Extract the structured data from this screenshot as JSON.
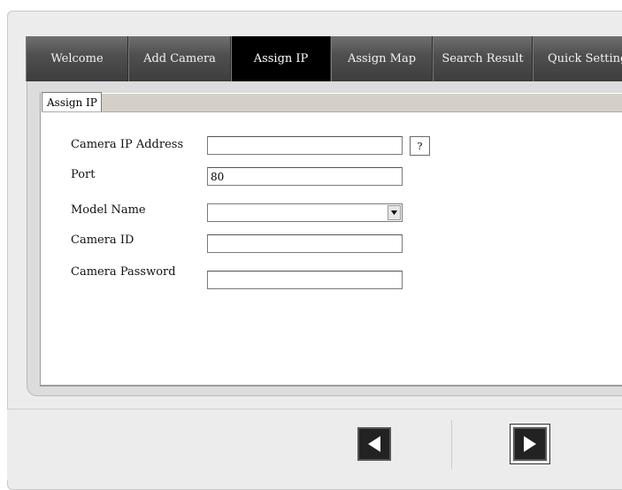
{
  "tabs": [
    {
      "label": "Welcome",
      "active": false
    },
    {
      "label": "Add Camera",
      "active": false
    },
    {
      "label": "Assign IP",
      "active": true
    },
    {
      "label": "Assign Map",
      "active": false
    },
    {
      "label": "Search Result",
      "active": false
    },
    {
      "label": "Quick Settings",
      "active": false
    }
  ],
  "panel": {
    "subtab_label": "Assign IP"
  },
  "form": {
    "camera_ip": {
      "label": "Camera IP Address",
      "value": "",
      "help_label": "?"
    },
    "port": {
      "label": "Port",
      "value": "80"
    },
    "model_name": {
      "label": "Model Name",
      "value": ""
    },
    "camera_id": {
      "label": "Camera ID",
      "value": ""
    },
    "camera_password": {
      "label": "Camera Password",
      "value": ""
    }
  },
  "navigation": {
    "back_icon": "triangle-left-icon",
    "next_icon": "triangle-right-icon"
  },
  "colors": {
    "tab_bar": "#505050",
    "active_tab": "#000000",
    "panel_bg": "#ffffff",
    "frame_bg": "#ececec"
  }
}
